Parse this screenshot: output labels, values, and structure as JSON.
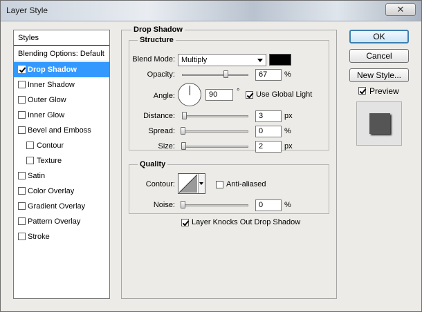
{
  "window": {
    "title": "Layer Style",
    "close_glyph": "✕"
  },
  "styles_list": {
    "header": "Styles",
    "blending": "Blending Options: Default",
    "items": [
      {
        "label": "Drop Shadow",
        "checked": true,
        "selected": true
      },
      {
        "label": "Inner Shadow",
        "checked": false
      },
      {
        "label": "Outer Glow",
        "checked": false
      },
      {
        "label": "Inner Glow",
        "checked": false
      },
      {
        "label": "Bevel and Emboss",
        "checked": false
      },
      {
        "label": "Contour",
        "checked": false,
        "indent": true
      },
      {
        "label": "Texture",
        "checked": false,
        "indent": true
      },
      {
        "label": "Satin",
        "checked": false
      },
      {
        "label": "Color Overlay",
        "checked": false
      },
      {
        "label": "Gradient Overlay",
        "checked": false
      },
      {
        "label": "Pattern Overlay",
        "checked": false
      },
      {
        "label": "Stroke",
        "checked": false
      }
    ]
  },
  "drop_shadow": {
    "title": "Drop Shadow",
    "structure": {
      "title": "Structure",
      "blend_mode_label": "Blend Mode:",
      "blend_mode_value": "Multiply",
      "shadow_color": "#000000",
      "opacity_label": "Opacity:",
      "opacity_value": "67",
      "opacity_unit": "%",
      "opacity_fraction": 0.67,
      "angle_label": "Angle:",
      "angle_value": "90",
      "angle_unit": "°",
      "use_global_light_label": "Use Global Light",
      "use_global_light": true,
      "distance_label": "Distance:",
      "distance_value": "3",
      "distance_unit": "px",
      "spread_label": "Spread:",
      "spread_value": "0",
      "spread_unit": "%",
      "size_label": "Size:",
      "size_value": "2",
      "size_unit": "px"
    },
    "quality": {
      "title": "Quality",
      "contour_label": "Contour:",
      "anti_aliased_label": "Anti-aliased",
      "anti_aliased": false,
      "noise_label": "Noise:",
      "noise_value": "0",
      "noise_unit": "%"
    },
    "knockout_label": "Layer Knocks Out Drop Shadow",
    "knockout": true
  },
  "buttons": {
    "ok": "OK",
    "cancel": "Cancel",
    "new_style": "New Style..."
  },
  "preview": {
    "label": "Preview",
    "checked": true
  },
  "colors": {
    "selection": "#3399ff",
    "dialog_bg": "#ecebe7"
  }
}
